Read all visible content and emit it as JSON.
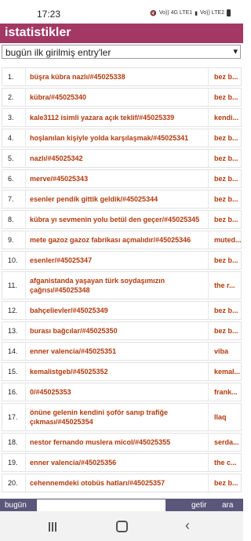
{
  "status": {
    "time": "17:23",
    "icons": [
      "mute-icon",
      "signal-icon",
      "wifi-icon",
      "battery-icon"
    ],
    "network_1": "Vo)) 4G LTE1",
    "network_2": "Vo)) LTE2"
  },
  "header": {
    "title": "istatistikler"
  },
  "filter": {
    "selected": "bugün ilk girilmiş entry'ler"
  },
  "rows": [
    {
      "n": "1.",
      "entry": "büşra kübra nazlı/#45025338",
      "author": "bez b..."
    },
    {
      "n": "2.",
      "entry": "kübra/#45025340",
      "author": "bez b..."
    },
    {
      "n": "3.",
      "entry": "kale3112 isimli yazara açık teklif/#45025339",
      "author": "kendi..."
    },
    {
      "n": "4.",
      "entry": "hoşlanılan kişiyle yolda karşılaşmak/#45025341",
      "author": "bez b..."
    },
    {
      "n": "5.",
      "entry": "nazlı/#45025342",
      "author": "bez b..."
    },
    {
      "n": "6.",
      "entry": "merve/#45025343",
      "author": "bez b..."
    },
    {
      "n": "7.",
      "entry": "esenler pendik gittik geldik/#45025344",
      "author": "bez b..."
    },
    {
      "n": "8.",
      "entry": "kübra yı sevmenin yolu betül den geçer/#45025345",
      "author": "bez b..."
    },
    {
      "n": "9.",
      "entry": "mete gazoz gazoz fabrikası açmalıdır/#45025346",
      "author": "muted..."
    },
    {
      "n": "10.",
      "entry": "esenler/#45025347",
      "author": "bez b..."
    },
    {
      "n": "11.",
      "entry": "afganistanda yaşayan türk soydaşımızın çağrısı/#45025348",
      "author": "the r..."
    },
    {
      "n": "12.",
      "entry": "bahçelievler/#45025349",
      "author": "bez b..."
    },
    {
      "n": "13.",
      "entry": "burası bağcılar/#45025350",
      "author": "bez b..."
    },
    {
      "n": "14.",
      "entry": "enner valencia/#45025351",
      "author": "viba"
    },
    {
      "n": "15.",
      "entry": "kemalistgeb/#45025352",
      "author": "kemal..."
    },
    {
      "n": "16.",
      "entry": "0/#45025353",
      "author": "frank..."
    },
    {
      "n": "17.",
      "entry": "önüne gelenin kendini şoför sanıp trafiğe çıkması/#45025354",
      "author": "llaq"
    },
    {
      "n": "18.",
      "entry": "nestor fernando muslera micol/#45025355",
      "author": "serda..."
    },
    {
      "n": "19.",
      "entry": "enner valencia/#45025356",
      "author": "the c..."
    },
    {
      "n": "20.",
      "entry": "cehennemdeki otobüs hatları/#45025357",
      "author": "bez b..."
    }
  ],
  "bottom": {
    "label": "bugün",
    "input_value": "",
    "go_label": "getir",
    "search_label": "ara"
  },
  "colors": {
    "header_bg": "#a33864",
    "link": "#b23a0e",
    "bottom_bg": "#5b577a"
  }
}
